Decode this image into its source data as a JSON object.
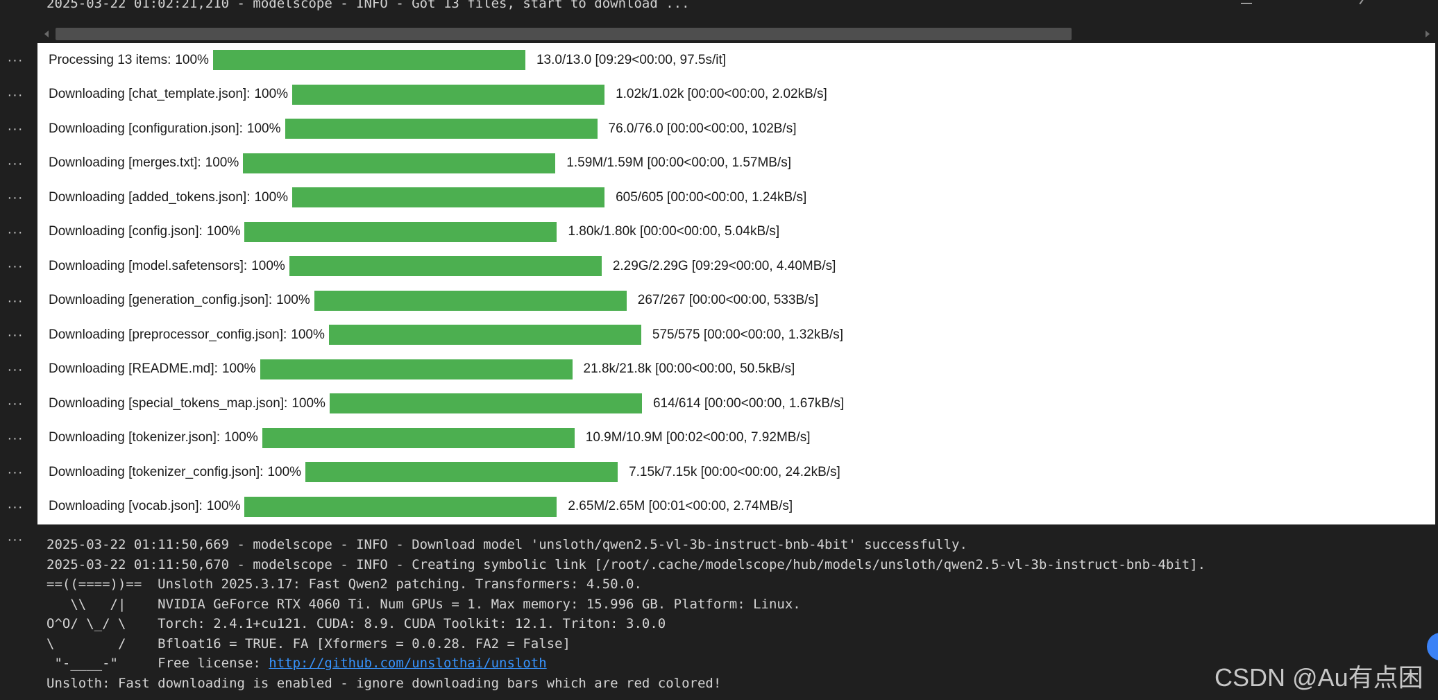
{
  "top_log": "2025-03-22 01:02:21,210 - modelscope - INFO - Got 13 files, start to download ...",
  "gutter_symbol": "···",
  "progress_rows": [
    {
      "label": "Processing 13 items:",
      "pct": "100%",
      "stats": "13.0/13.0 [09:29<00:00, 97.5s/it]",
      "progress": 1.0
    },
    {
      "label": "Downloading [chat_template.json]:",
      "pct": "100%",
      "stats": "1.02k/1.02k [00:00<00:00, 2.02kB/s]",
      "progress": 1.0
    },
    {
      "label": "Downloading [configuration.json]:",
      "pct": "100%",
      "stats": "76.0/76.0 [00:00<00:00, 102B/s]",
      "progress": 1.0
    },
    {
      "label": "Downloading [merges.txt]:",
      "pct": "100%",
      "stats": "1.59M/1.59M [00:00<00:00, 1.57MB/s]",
      "progress": 1.0
    },
    {
      "label": "Downloading [added_tokens.json]:",
      "pct": "100%",
      "stats": "605/605 [00:00<00:00, 1.24kB/s]",
      "progress": 1.0
    },
    {
      "label": "Downloading [config.json]:",
      "pct": "100%",
      "stats": "1.80k/1.80k [00:00<00:00, 5.04kB/s]",
      "progress": 1.0
    },
    {
      "label": "Downloading [model.safetensors]:",
      "pct": "100%",
      "stats": "2.29G/2.29G [09:29<00:00, 4.40MB/s]",
      "progress": 1.0
    },
    {
      "label": "Downloading [generation_config.json]:",
      "pct": "100%",
      "stats": "267/267 [00:00<00:00, 533B/s]",
      "progress": 1.0
    },
    {
      "label": "Downloading [preprocessor_config.json]:",
      "pct": "100%",
      "stats": "575/575 [00:00<00:00, 1.32kB/s]",
      "progress": 1.0
    },
    {
      "label": "Downloading [README.md]:",
      "pct": "100%",
      "stats": "21.8k/21.8k [00:00<00:00, 50.5kB/s]",
      "progress": 1.0
    },
    {
      "label": "Downloading [special_tokens_map.json]:",
      "pct": "100%",
      "stats": "614/614 [00:00<00:00, 1.67kB/s]",
      "progress": 1.0
    },
    {
      "label": "Downloading [tokenizer.json]:",
      "pct": "100%",
      "stats": "10.9M/10.9M [00:02<00:00, 7.92MB/s]",
      "progress": 1.0
    },
    {
      "label": "Downloading [tokenizer_config.json]:",
      "pct": "100%",
      "stats": "7.15k/7.15k [00:00<00:00, 24.2kB/s]",
      "progress": 1.0
    },
    {
      "label": "Downloading [vocab.json]:",
      "pct": "100%",
      "stats": "2.65M/2.65M [00:01<00:00, 2.74MB/s]",
      "progress": 1.0
    }
  ],
  "bottom_log": {
    "line1": "2025-03-22 01:11:50,669 - modelscope - INFO - Download model 'unsloth/qwen2.5-vl-3b-instruct-bnb-4bit' successfully.",
    "line2": "2025-03-22 01:11:50,670 - modelscope - INFO - Creating symbolic link [/root/.cache/modelscope/hub/models/unsloth/qwen2.5-vl-3b-instruct-bnb-4bit].",
    "line3": "==((====))==  Unsloth 2025.3.17: Fast Qwen2 patching. Transformers: 4.50.0.",
    "line4": "   \\\\   /|    NVIDIA GeForce RTX 4060 Ti. Num GPUs = 1. Max memory: 15.996 GB. Platform: Linux.",
    "line5": "O^O/ \\_/ \\    Torch: 2.4.1+cu121. CUDA: 8.9. CUDA Toolkit: 12.1. Triton: 3.0.0",
    "line6": "\\        /    Bfloat16 = TRUE. FA [Xformers = 0.0.28. FA2 = False]",
    "line7_prefix": " \"-____-\"     Free license: ",
    "line7_link": "http://github.com/unslothai/unsloth",
    "line8": "Unsloth: Fast downloading is enabled - ignore downloading bars which are red colored!"
  },
  "watermark": "CSDN @Au有点困",
  "colors": {
    "bar": "#4caf50",
    "link": "#3794ff",
    "bg": "#1f1f1f"
  }
}
